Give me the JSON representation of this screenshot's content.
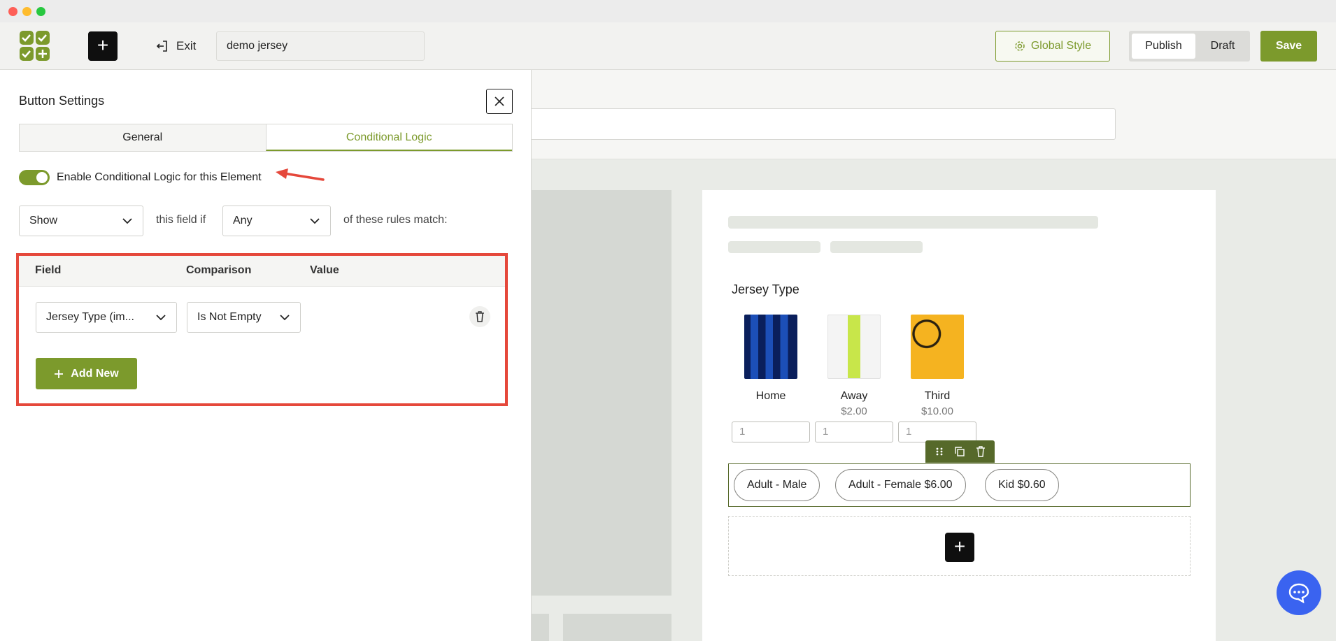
{
  "toolbar": {
    "exit_label": "Exit",
    "doc_title": "demo jersey",
    "global_style_label": "Global Style",
    "publish_label": "Publish",
    "draft_label": "Draft",
    "save_label": "Save"
  },
  "settings": {
    "title": "Button Settings",
    "tabs": [
      {
        "label": "General",
        "active": false
      },
      {
        "label": "Conditional Logic",
        "active": true
      }
    ],
    "toggle_label": "Enable Conditional Logic for this Element",
    "toggle_on": true,
    "action_select": "Show",
    "text_field_if": "this field if",
    "match_select": "Any",
    "text_rules_match": "of these rules match:",
    "rules": {
      "headers": {
        "field": "Field",
        "comparison": "Comparison",
        "value": "Value"
      },
      "rows": [
        {
          "field": "Jersey Type (im...",
          "comparison": "Is Not Empty"
        }
      ],
      "add_new_label": "Add New"
    }
  },
  "canvas": {
    "section_title": "Jersey Type",
    "products": [
      {
        "name": "Home",
        "price": "",
        "qty": "1"
      },
      {
        "name": "Away",
        "price": "$2.00",
        "qty": "1"
      },
      {
        "name": "Third",
        "price": "$10.00",
        "qty": "1"
      }
    ],
    "options": [
      {
        "label": "Adult - Male"
      },
      {
        "label": "Adult - Female  $6.00"
      },
      {
        "label": "Kid  $0.60"
      }
    ]
  },
  "colors": {
    "accent": "#7c9a2c",
    "annotation_red": "#e5483b",
    "chat_blue": "#3a63f0"
  },
  "icons": [
    "logo-icon",
    "plus-icon",
    "exit-icon",
    "gear-icon",
    "close-icon",
    "chevron-down-icon",
    "trash-icon",
    "drag-handle-icon",
    "duplicate-icon",
    "chat-icon"
  ]
}
